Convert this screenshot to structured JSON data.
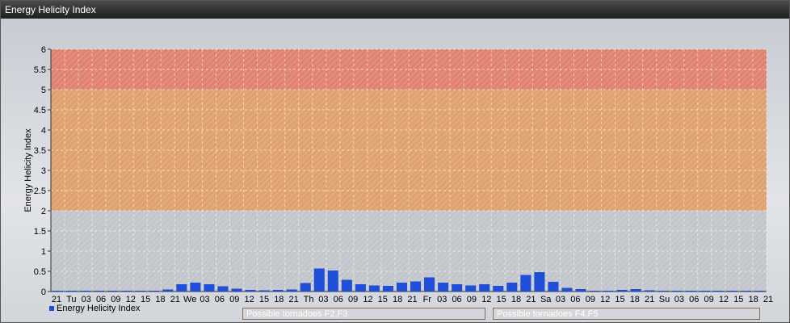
{
  "window": {
    "title": "Energy Helicity Index"
  },
  "colors": {
    "bar": "#1f4fd8",
    "zone_high": "#e0806a",
    "zone_mid": "#e0a068",
    "zone_low_grid": "#c4c8cc",
    "flag_mid": "#c48a62",
    "flag_high": "#c0706a"
  },
  "legend": {
    "label": "Energy Helicity Index"
  },
  "zones": [
    {
      "label": "Possible tornadoes F2,F3",
      "from": 2,
      "to": 5
    },
    {
      "label": "Possible tornadoes F4,F5",
      "from": 5,
      "to": 6
    }
  ],
  "chart_data": {
    "type": "bar",
    "title": "Energy Helicity Index",
    "xlabel": "",
    "ylabel": "Energy Helicity Index",
    "ylim": [
      0,
      6
    ],
    "yticks": [
      "0",
      "0.5",
      "1",
      "1.5",
      "2",
      "2.5",
      "3",
      "3.5",
      "4",
      "4.5",
      "5",
      "5.5",
      "6"
    ],
    "grid": true,
    "categories": [
      "21",
      "Tu",
      "03",
      "06",
      "09",
      "12",
      "15",
      "18",
      "21",
      "We",
      "03",
      "06",
      "09",
      "12",
      "15",
      "18",
      "21",
      "Th",
      "03",
      "06",
      "09",
      "12",
      "15",
      "18",
      "21",
      "Fr",
      "03",
      "06",
      "09",
      "12",
      "15",
      "18",
      "21",
      "Sa",
      "03",
      "06",
      "09",
      "12",
      "15",
      "18",
      "21",
      "Su",
      "03",
      "06",
      "09",
      "12",
      "15",
      "18",
      "21"
    ],
    "bar_categories_note": "",
    "values": [
      0.02,
      0.02,
      0.02,
      0.02,
      0.02,
      0.02,
      0.02,
      0.02,
      0.05,
      0.18,
      0.22,
      0.18,
      0.13,
      0.07,
      0.04,
      0.03,
      0.04,
      0.05,
      0.21,
      0.57,
      0.52,
      0.29,
      0.18,
      0.15,
      0.14,
      0.22,
      0.25,
      0.35,
      0.22,
      0.18,
      0.15,
      0.18,
      0.14,
      0.22,
      0.41,
      0.48,
      0.24,
      0.09,
      0.06,
      0.02,
      0.02,
      0.04,
      0.06,
      0.03,
      0.02,
      0.02,
      0.02,
      0.02,
      0.02,
      0.02,
      0.02,
      0.02
    ]
  }
}
